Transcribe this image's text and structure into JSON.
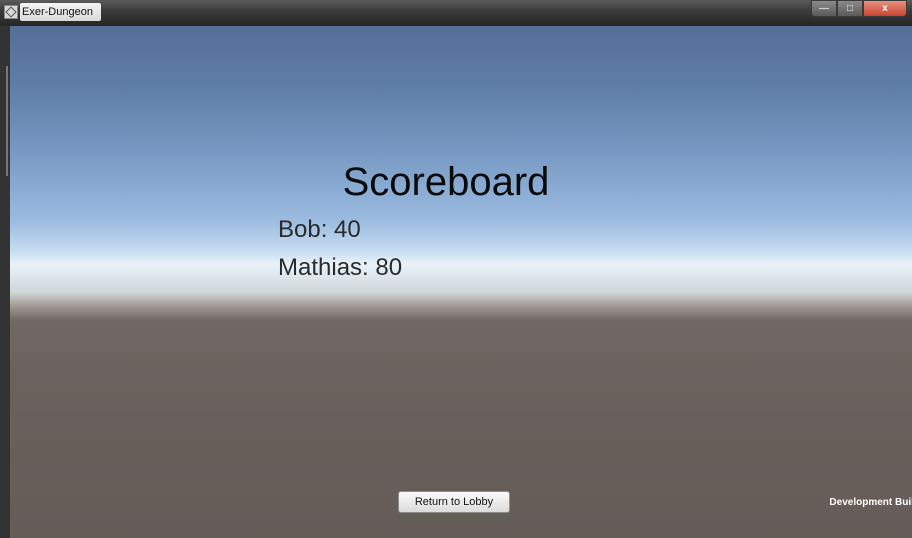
{
  "window": {
    "title": "Exer-Dungeon",
    "controls": {
      "minimize": "—",
      "maximize": "□",
      "close": "x"
    }
  },
  "scoreboard": {
    "title": "Scoreboard",
    "entries": [
      {
        "text": "Bob: 40"
      },
      {
        "text": "Mathias: 80"
      }
    ]
  },
  "footer": {
    "return_button_label": "Return to Lobby",
    "build_label": "Development Build"
  }
}
